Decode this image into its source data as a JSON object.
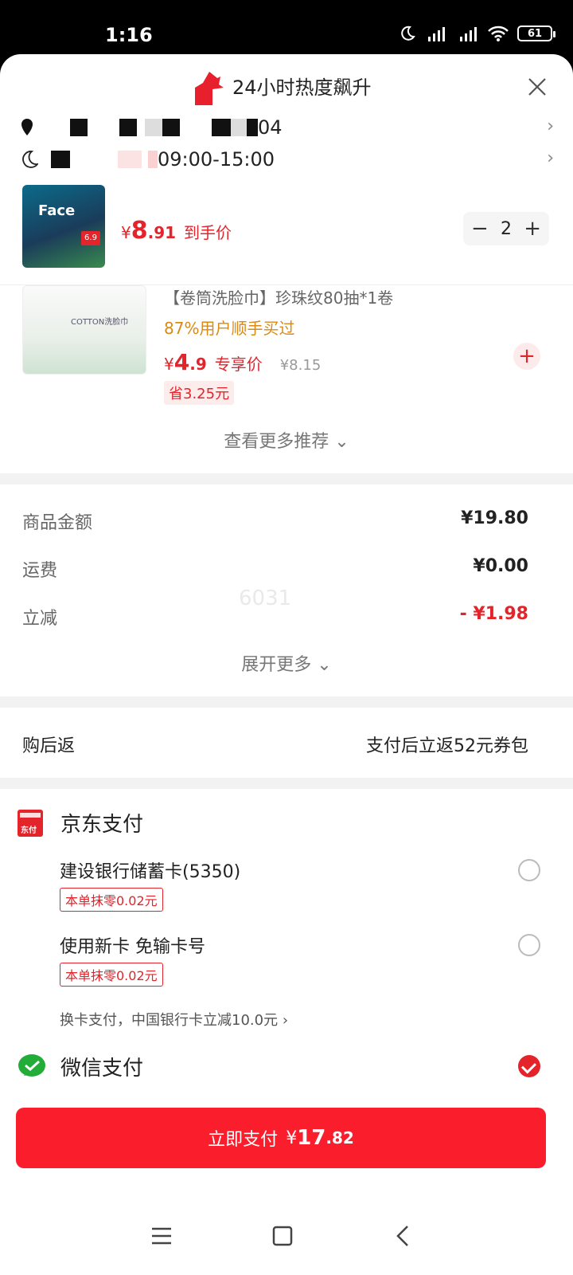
{
  "status_bar": {
    "time": "1:16",
    "battery": "61"
  },
  "header": {
    "title": "24小时热度飙升"
  },
  "address_row": {
    "text_tail": "04"
  },
  "delivery_row": {
    "time_range": "09:00-15:00"
  },
  "product": {
    "price_symbol": "¥",
    "price_int": "8",
    "price_dec": ".91",
    "price_label": "到手价",
    "quantity": "2",
    "thumb_text": "Face",
    "thumb_tag": "6.9"
  },
  "recommend": {
    "title": "【卷筒洗脸巾】珍珠纹80抽*1卷",
    "hint": "87%用户顺手买过",
    "price_symbol": "¥",
    "price_int": "4",
    "price_dec": ".9",
    "price_label": "专享价",
    "old_price": "¥8.15",
    "save": "省3.25元",
    "thumb_label": "COTTON洗脸巾"
  },
  "more_recommend": "查看更多推荐",
  "summary": {
    "rows": [
      {
        "label": "商品金额",
        "value": "¥19.80"
      },
      {
        "label": "运费",
        "value": "¥0.00"
      },
      {
        "label": "立减",
        "value": "- ¥1.98"
      }
    ],
    "expand": "展开更多",
    "watermark": "6031"
  },
  "cashback": {
    "label": "购后返",
    "value": "支付后立返52元券包"
  },
  "payment": {
    "jd_title": "京东支付",
    "jd_icon_text": "东付",
    "options": [
      {
        "label": "建设银行储蓄卡(5350)",
        "tag": "本单抹零0.02元"
      },
      {
        "label": "使用新卡 免输卡号",
        "tag": "本单抹零0.02元"
      }
    ],
    "swap_card": "换卡支付，中国银行卡立减10.0元",
    "wechat_title": "微信支付"
  },
  "pay_button": {
    "label": "立即支付",
    "symbol": "¥",
    "int": "17",
    "dec": ".82"
  },
  "colors": {
    "accent": "#e3242b",
    "button": "#fa1e2c",
    "hint": "#d98a14"
  }
}
